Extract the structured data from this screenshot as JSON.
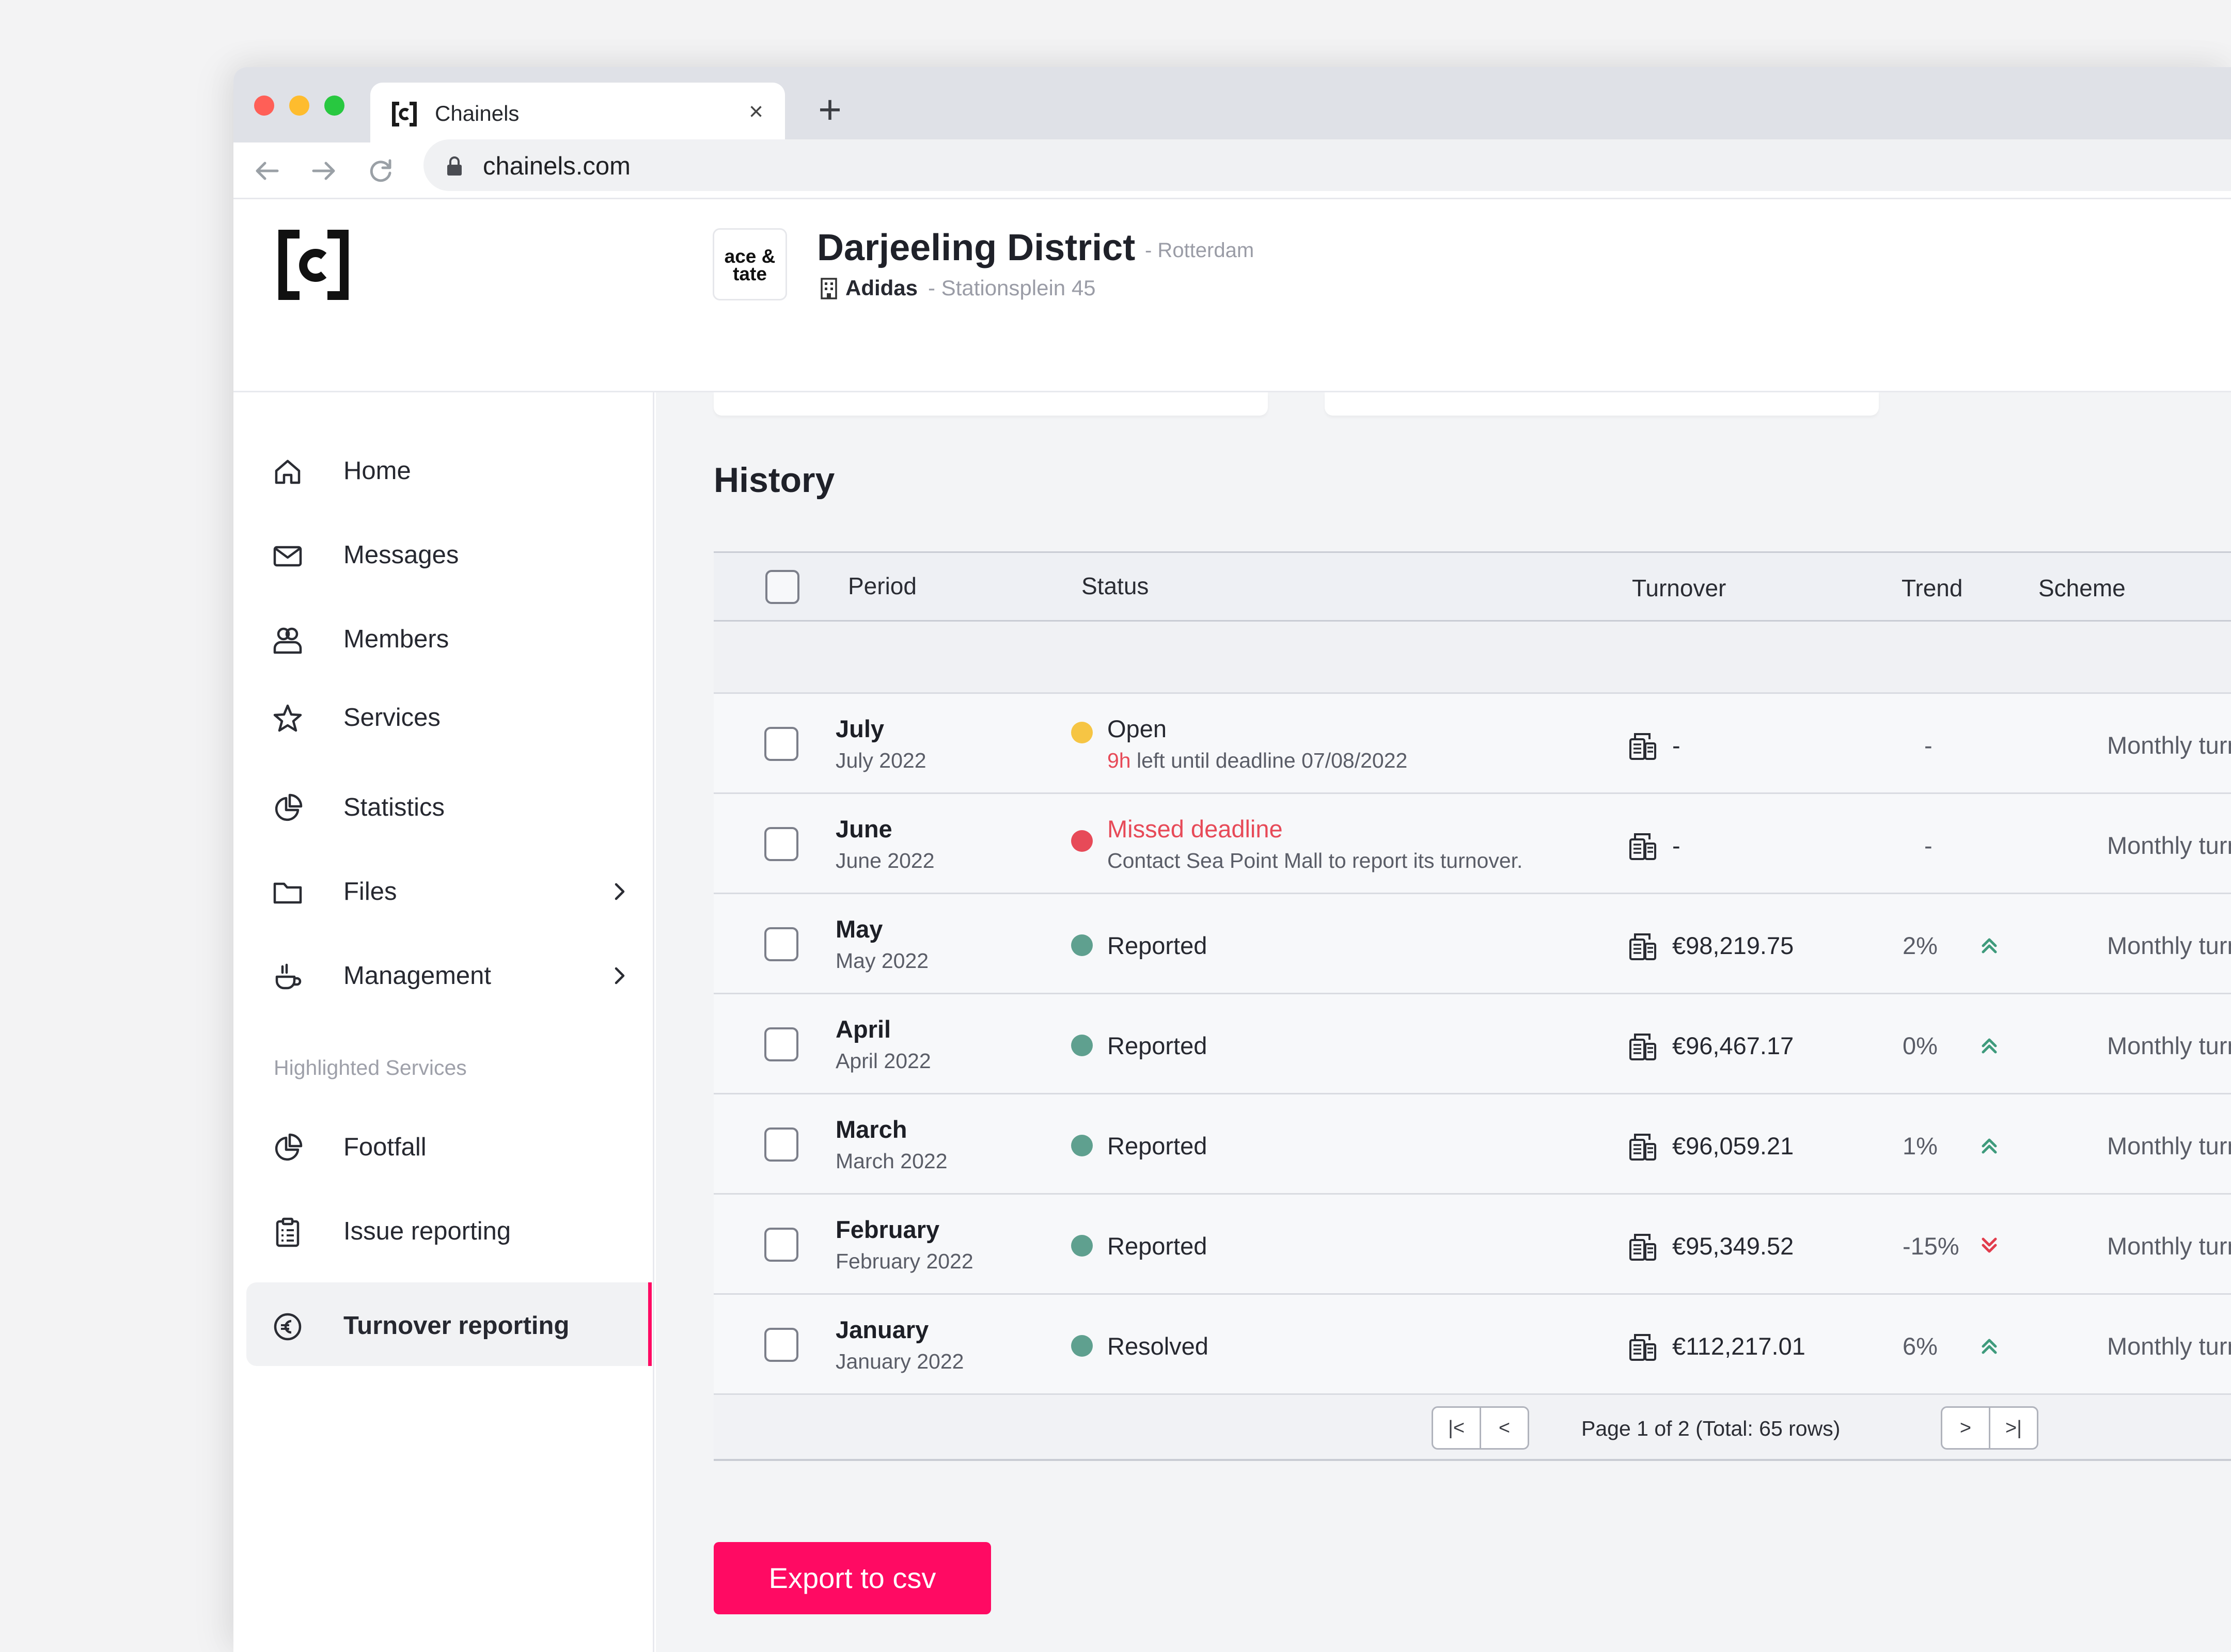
{
  "browser": {
    "tab_title": "Chainels",
    "close_glyph": "×",
    "new_tab_glyph": "+",
    "url": "chainels.com"
  },
  "header": {
    "store_logo": [
      "ace &",
      "tate"
    ],
    "mall_name": "Darjeeling District",
    "mall_city": "- Rotterdam",
    "tenant": "Adidas",
    "address": "- Stationsplein 45"
  },
  "sidebar": {
    "items": [
      {
        "label": "Home",
        "icon": "home-icon"
      },
      {
        "label": "Messages",
        "icon": "mail-icon"
      },
      {
        "label": "Members",
        "icon": "members-icon"
      },
      {
        "label": "Services",
        "icon": "star-icon"
      },
      {
        "label": "Statistics",
        "icon": "pie-chart-icon"
      },
      {
        "label": "Files",
        "icon": "folder-icon"
      },
      {
        "label": "Management",
        "icon": "coffee-cup-icon"
      }
    ],
    "section_label": "Highlighted Services",
    "highlighted": [
      {
        "label": "Footfall",
        "icon": "pie-chart-icon"
      },
      {
        "label": "Issue reporting",
        "icon": "clipboard-icon"
      },
      {
        "label": "Turnover reporting",
        "icon": "euro-icon"
      }
    ]
  },
  "history": {
    "title": "History",
    "columns": [
      "Period",
      "Status",
      "Turnover",
      "Trend",
      "Scheme"
    ],
    "rows": [
      {
        "period": "July",
        "sub": "July 2022",
        "status": "Open",
        "status_highlight": "9h",
        "status_sub": " left until deadline 07/08/2022",
        "turnover": "-",
        "trend": "-",
        "scheme": "Monthly turnove"
      },
      {
        "period": "June",
        "sub": "June 2022",
        "status": "Missed deadline",
        "status_sub": "Contact Sea Point Mall to report its turnover.",
        "turnover": "-",
        "trend": "-",
        "scheme": "Monthly turnove"
      },
      {
        "period": "May",
        "sub": "May 2022",
        "status": "Reported",
        "turnover": "€98,219.75",
        "trend": "2%",
        "scheme": "Monthly turnove"
      },
      {
        "period": "April",
        "sub": "April 2022",
        "status": "Reported",
        "turnover": "€96,467.17",
        "trend": "0%",
        "scheme": "Monthly turnove"
      },
      {
        "period": "March",
        "sub": "March 2022",
        "status": "Reported",
        "turnover": "€96,059.21",
        "trend": "1%",
        "scheme": "Monthly turnove"
      },
      {
        "period": "February",
        "sub": "February 2022",
        "status": "Reported",
        "turnover": "€95,349.52",
        "trend": "-15%",
        "scheme": "Monthly turnove"
      },
      {
        "period": "January",
        "sub": "January 2022",
        "status": "Resolved",
        "turnover": "€112,217.01",
        "trend": "6%",
        "scheme": "Monthly turnove"
      }
    ],
    "pager": {
      "first": "|<",
      "prev": "<",
      "info": "Page 1 of 2 (Total: 65 rows)",
      "next": ">",
      "last": ">|"
    }
  },
  "export_label": "Export to csv",
  "colors": {
    "accent": "#ff0a63",
    "status_open": "#f6c544",
    "status_missed": "#e74a58",
    "status_done": "#5fa08f",
    "trend_up": "#3f9b7c",
    "trend_down": "#e23d4d"
  }
}
